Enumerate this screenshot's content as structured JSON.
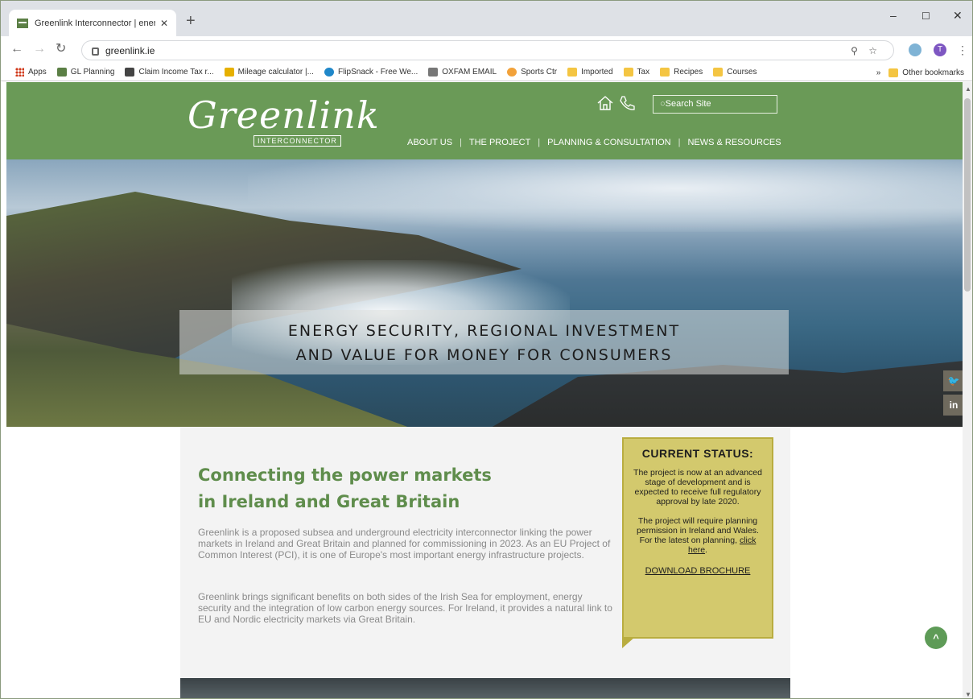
{
  "browser": {
    "tab_title": "Greenlink Interconnector | energ",
    "tab_close": "✕",
    "new_tab": "+",
    "url": "greenlink.ie",
    "window_minimize": "–",
    "window_maximize": "☐",
    "window_close": "✕",
    "profile_initial": "T",
    "menu": "⋮",
    "bookmarks": [
      {
        "label": "Apps",
        "icon": "apps-grid"
      },
      {
        "label": "GL Planning",
        "icon": "green"
      },
      {
        "label": "Claim Income Tax r...",
        "icon": "dark"
      },
      {
        "label": "Mileage calculator |...",
        "icon": "yellow"
      },
      {
        "label": "FlipSnack - Free We...",
        "icon": "blue"
      },
      {
        "label": "OXFAM EMAIL",
        "icon": "grey"
      },
      {
        "label": "Sports Ctr",
        "icon": "orange"
      },
      {
        "label": "Imported",
        "icon": "folder"
      },
      {
        "label": "Tax",
        "icon": "folder"
      },
      {
        "label": "Recipes",
        "icon": "folder"
      },
      {
        "label": "Courses",
        "icon": "folder"
      }
    ],
    "bookmarks_overflow": "»",
    "other_bookmarks": "Other bookmarks"
  },
  "site": {
    "logo_text": "Greenlink",
    "logo_sub": "INTERCONNECTOR",
    "search_placeholder": "Search Site",
    "nav": [
      "ABOUT US",
      "THE PROJECT",
      "PLANNING & CONSULTATION",
      "NEWS & RESOURCES"
    ]
  },
  "hero": {
    "line1": "ENERGY SECURITY, REGIONAL INVESTMENT",
    "line2": "AND VALUE FOR MONEY FOR CONSUMERS",
    "twitter": "🐦",
    "linkedin": "in"
  },
  "main": {
    "headline_line1": "Connecting the power markets",
    "headline_line2": "in Ireland and Great Britain",
    "para1": "Greenlink is a proposed subsea and underground electricity interconnector linking the power markets in Ireland and Great Britain and planned for commissioning in 2023. As an EU Project of Common Interest (PCI), it is one of Europe's most important energy infrastructure projects.",
    "para2": "Greenlink brings significant benefits on both sides of the Irish Sea for employment, energy security and the integration of low carbon energy sources. For Ireland, it provides a natural link to EU and Nordic electricity markets via Great Britain."
  },
  "status": {
    "title": "CURRENT STATUS:",
    "text1": "The project is now at an advanced stage of development and is expected to receive full regulatory approval by late 2020.",
    "text2_prefix": "The project will require planning permission in Ireland and Wales. For the latest on planning, ",
    "text2_link": "click here",
    "text2_suffix": ".",
    "download": "DOWNLOAD BROCHURE"
  },
  "back_to_top": "^"
}
